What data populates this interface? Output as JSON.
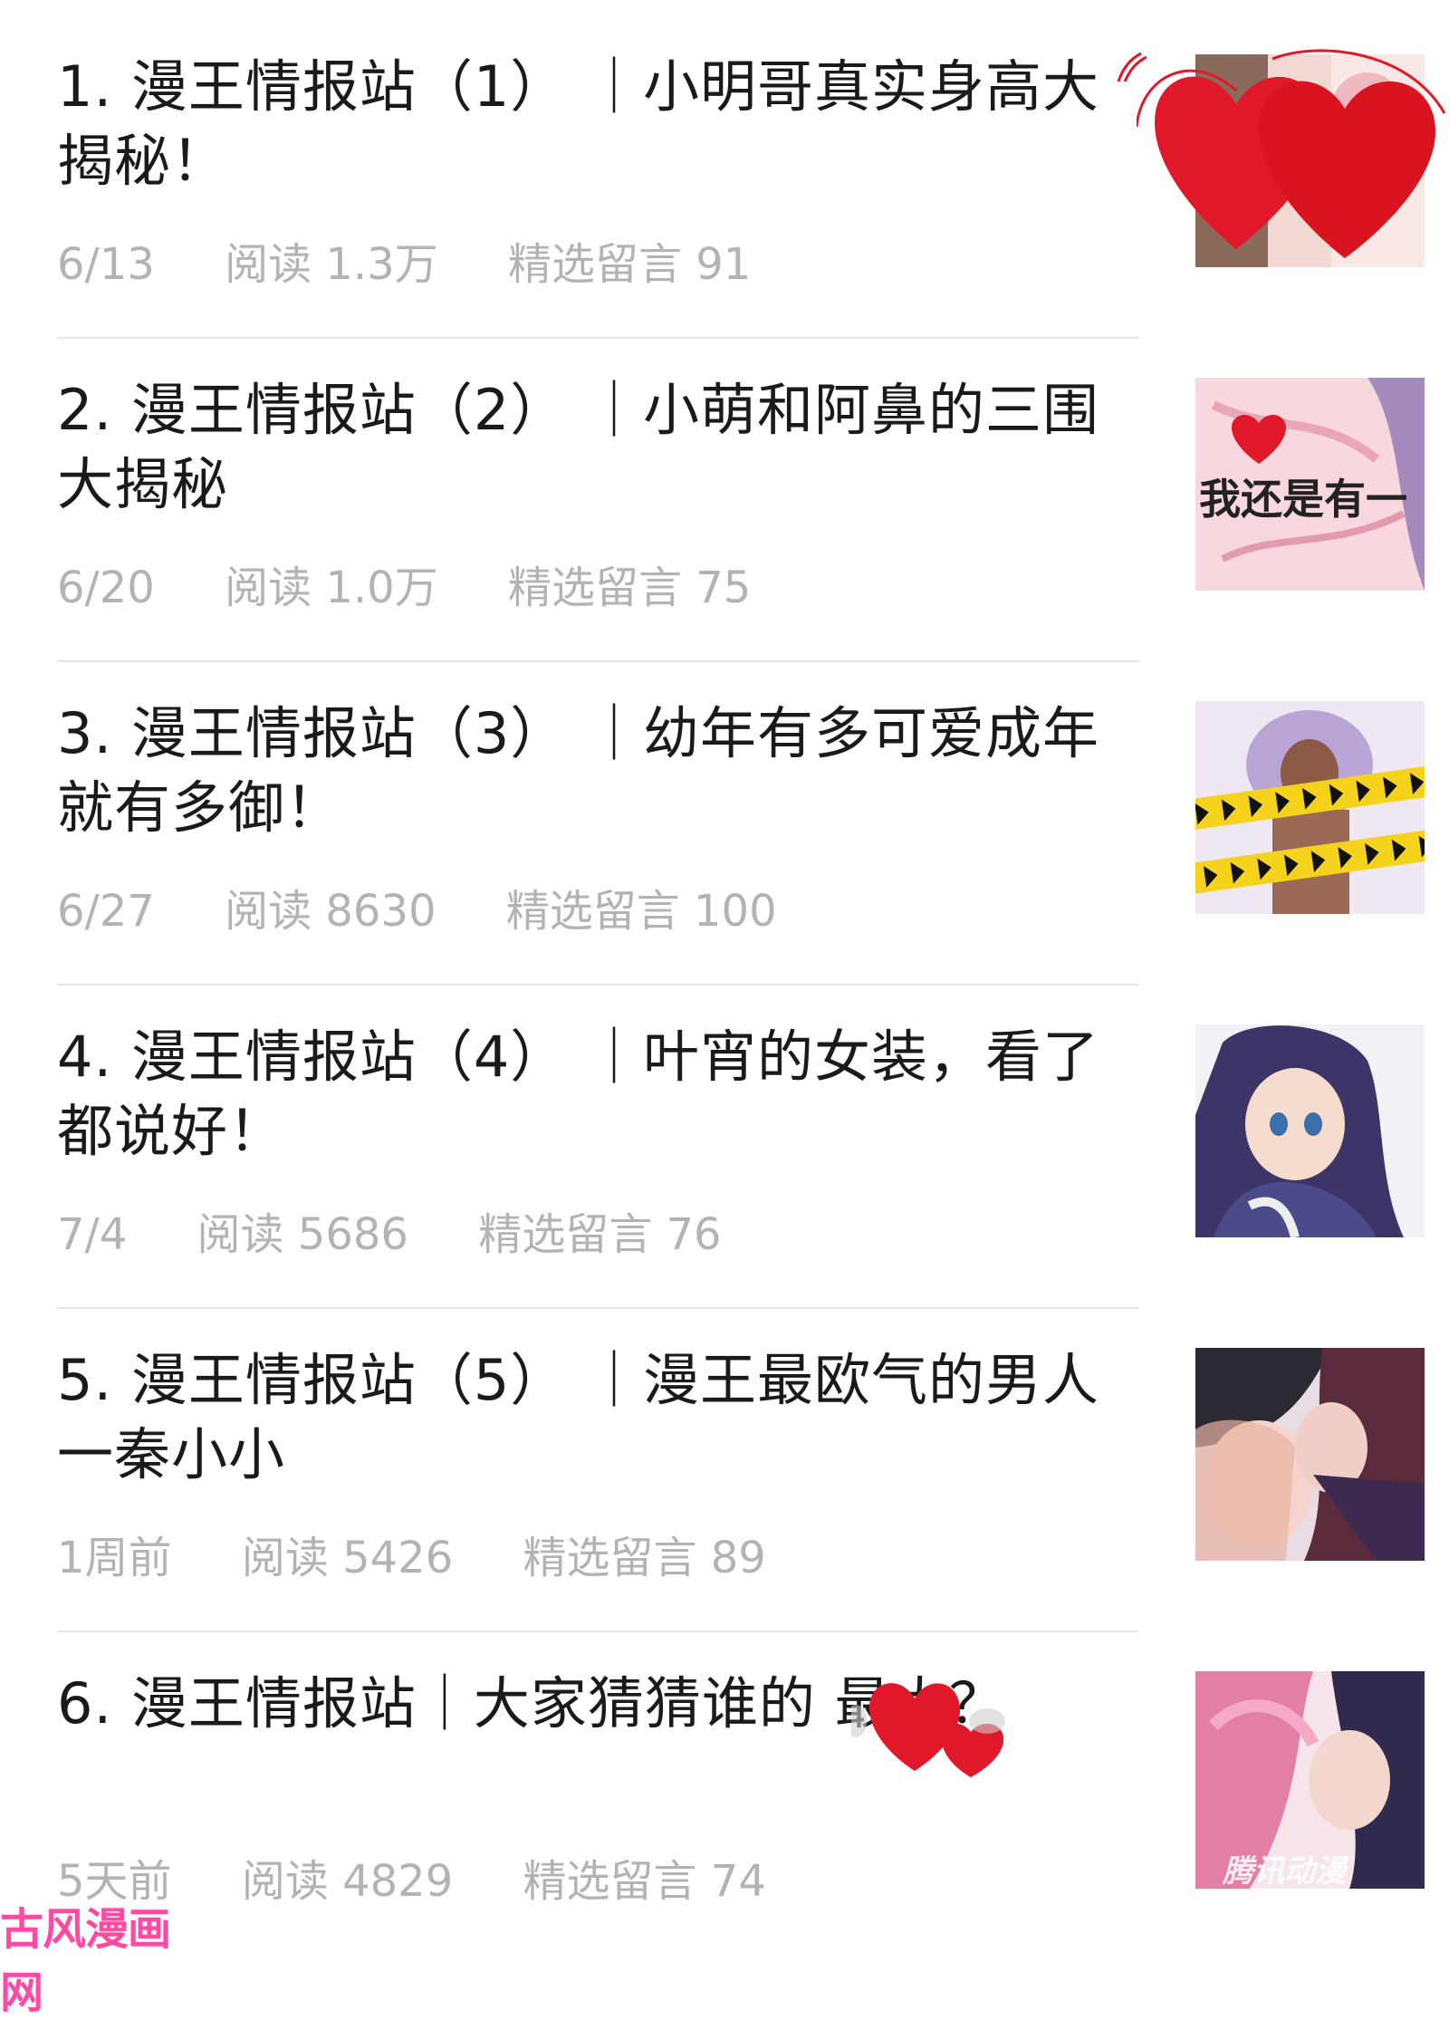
{
  "articles": [
    {
      "title": "1. 漫王情报站（1） ｜小明哥真实身高大揭秘！",
      "date": "6/13",
      "reads": "阅读 1.3万",
      "comments": "精选留言 91"
    },
    {
      "title": "2. 漫王情报站（2） ｜小萌和阿鼻的三围大揭秘",
      "date": "6/20",
      "reads": "阅读 1.0万",
      "comments": "精选留言 75"
    },
    {
      "title": "3. 漫王情报站（3） ｜幼年有多可爱成年就有多御！",
      "date": "6/27",
      "reads": "阅读 8630",
      "comments": "精选留言 100"
    },
    {
      "title": "4. 漫王情报站（4） ｜叶宵的女装，看了都说好！",
      "date": "7/4",
      "reads": "阅读 5686",
      "comments": "精选留言 76"
    },
    {
      "title": "5. 漫王情报站（5） ｜漫王最欧气的男人一秦小小",
      "date": "1周前",
      "reads": "阅读 5426",
      "comments": "精选留言 89"
    },
    {
      "title": "6. 漫王情报站｜大家猜猜谁的 最大？",
      "date": "5天前",
      "reads": "阅读 4829",
      "comments": "精选留言 74"
    }
  ],
  "thumbnails": [
    {
      "icon": "hearts-covered-thumbnail"
    },
    {
      "icon": "manga-panel-thumbnail",
      "caption": "我还是有一"
    },
    {
      "icon": "caution-tape-thumbnail"
    },
    {
      "icon": "anime-girl-thumbnail"
    },
    {
      "icon": "couple-thumbnail"
    },
    {
      "icon": "pink-hair-thumbnail",
      "caption": "腾讯动漫"
    }
  ],
  "watermark": "古风漫画网",
  "colors": {
    "title": "#1a1a1a",
    "meta": "#b3b3b3",
    "divider": "#e6e6e6",
    "heart": "#e0182a"
  }
}
